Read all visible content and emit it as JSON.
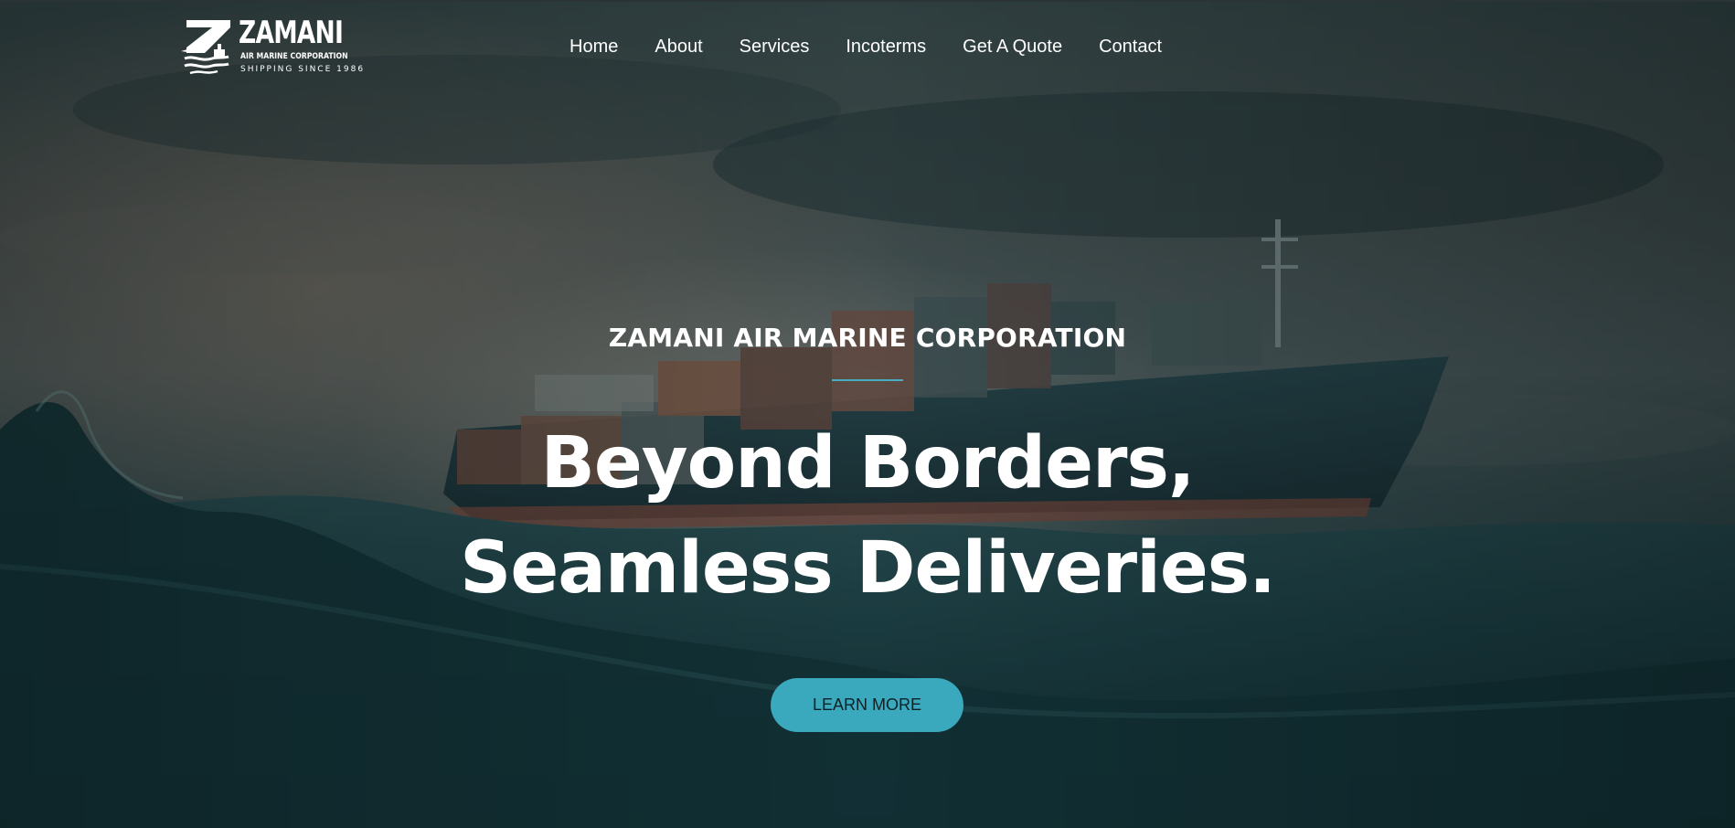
{
  "logo": {
    "name": "ZAMANI",
    "subtitle": "AIR MARINE CORPORATION",
    "tagline": "SHIPPING SINCE 1986"
  },
  "nav": {
    "items": [
      {
        "label": "Home"
      },
      {
        "label": "About"
      },
      {
        "label": "Services"
      },
      {
        "label": "Incoterms"
      },
      {
        "label": "Get A Quote"
      },
      {
        "label": "Contact"
      }
    ]
  },
  "hero": {
    "eyebrow": "ZAMANI AIR MARINE CORPORATION",
    "headline_line1": "Beyond Borders,",
    "headline_line2": "Seamless Deliveries.",
    "cta_label": "LEARN MORE"
  },
  "colors": {
    "accent": "#3aa8bd",
    "divider": "#4aaec2",
    "background_dark": "#1f3a3d"
  }
}
